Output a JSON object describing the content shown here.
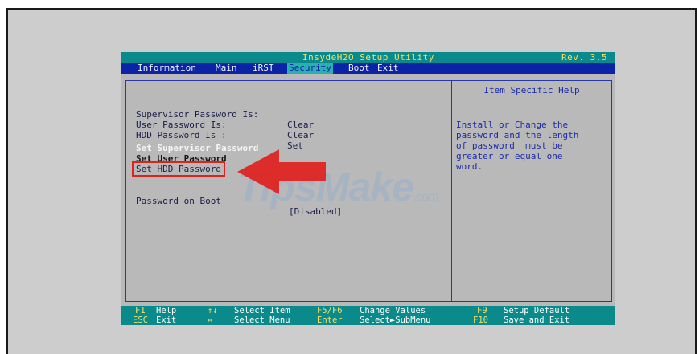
{
  "title": "InsydeH2O Setup Utility",
  "revision": "Rev. 3.5",
  "menu": [
    "Information",
    "Main",
    "iRST",
    "Security",
    "Boot",
    "Exit"
  ],
  "active_menu": "Security",
  "status": [
    {
      "label": "Supervisor Password Is:",
      "value": "Clear"
    },
    {
      "label": "User Password Is:",
      "value": "Clear"
    },
    {
      "label": "HDD Password Is :",
      "value": "Set"
    }
  ],
  "options": [
    "Set Supervisor Password",
    "Set User Password",
    "Set HDD Password"
  ],
  "boot_option": {
    "label": "Password on Boot",
    "value": "[Disabled]"
  },
  "help": {
    "header": "Item Specific Help",
    "lines": [
      "Install or Change the",
      "password and the length",
      "of password  must be",
      "greater or equal one",
      "word."
    ]
  },
  "footer": {
    "row1": [
      "F1",
      "Help",
      "↑↓",
      "Select Item",
      "F5/F6",
      "Change Values",
      "F9",
      "Setup Default"
    ],
    "row2": [
      "ESC",
      "Exit",
      "↔",
      "Select Menu",
      "Enter",
      "Select►SubMenu",
      "F10",
      "Save and Exit"
    ]
  },
  "watermark": {
    "main": "TipsMake",
    "suffix": ".com"
  },
  "colors": {
    "title_bar": "#0a8a8a",
    "menu_bar": "#0b23a6",
    "highlight": "#e0211d",
    "arrow": "#e0211d"
  }
}
